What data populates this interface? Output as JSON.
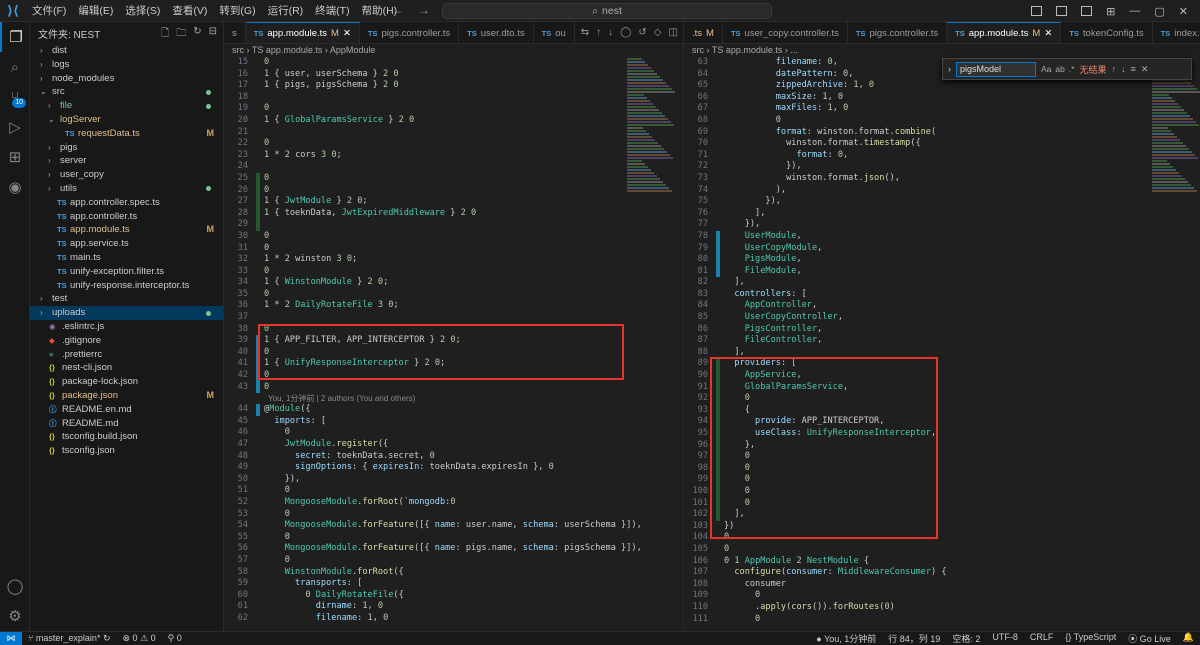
{
  "titlebar": {
    "menu": [
      "文件(F)",
      "编辑(E)",
      "选择(S)",
      "查看(V)",
      "转到(G)",
      "运行(R)",
      "终端(T)",
      "帮助(H)"
    ],
    "search": "nest"
  },
  "activity": {
    "scm_badge": "10"
  },
  "explorer": {
    "title": "文件夹: NEST",
    "items": [
      {
        "label": "dist",
        "indent": 0,
        "type": "folder",
        "open": false
      },
      {
        "label": "logs",
        "indent": 0,
        "type": "folder",
        "open": false
      },
      {
        "label": "node_modules",
        "indent": 0,
        "type": "folder",
        "open": false
      },
      {
        "label": "src",
        "indent": 0,
        "type": "folder",
        "open": true,
        "dot": true
      },
      {
        "label": "file",
        "indent": 1,
        "type": "folder",
        "open": false,
        "dot": true,
        "status": "green"
      },
      {
        "label": "logServer",
        "indent": 1,
        "type": "folder",
        "open": true,
        "status": "modified"
      },
      {
        "label": "requestData.ts",
        "indent": 2,
        "type": "ts",
        "badge": "M",
        "status": "modified"
      },
      {
        "label": "pigs",
        "indent": 1,
        "type": "folder",
        "open": false
      },
      {
        "label": "server",
        "indent": 1,
        "type": "folder",
        "open": false
      },
      {
        "label": "user_copy",
        "indent": 1,
        "type": "folder",
        "open": false
      },
      {
        "label": "utils",
        "indent": 1,
        "type": "folder",
        "open": false,
        "dot": true
      },
      {
        "label": "app.controller.spec.ts",
        "indent": 1,
        "type": "ts"
      },
      {
        "label": "app.controller.ts",
        "indent": 1,
        "type": "ts"
      },
      {
        "label": "app.module.ts",
        "indent": 1,
        "type": "ts",
        "badge": "M",
        "status": "modified"
      },
      {
        "label": "app.service.ts",
        "indent": 1,
        "type": "ts"
      },
      {
        "label": "main.ts",
        "indent": 1,
        "type": "ts"
      },
      {
        "label": "unify-exception.filter.ts",
        "indent": 1,
        "type": "ts"
      },
      {
        "label": "unify-response.interceptor.ts",
        "indent": 1,
        "type": "ts"
      },
      {
        "label": "test",
        "indent": 0,
        "type": "folder",
        "open": false
      },
      {
        "label": "uploads",
        "indent": 0,
        "type": "folder",
        "open": false,
        "dot": true,
        "selected": true
      },
      {
        "label": ".eslintrc.js",
        "indent": 0,
        "type": "eslint"
      },
      {
        "label": ".gitignore",
        "indent": 0,
        "type": "git"
      },
      {
        "label": ".prettierrc",
        "indent": 0,
        "type": "prettier"
      },
      {
        "label": "nest-cli.json",
        "indent": 0,
        "type": "json"
      },
      {
        "label": "package-lock.json",
        "indent": 0,
        "type": "json"
      },
      {
        "label": "package.json",
        "indent": 0,
        "type": "json",
        "badge": "M",
        "status": "modified"
      },
      {
        "label": "README.en.md",
        "indent": 0,
        "type": "md"
      },
      {
        "label": "README.md",
        "indent": 0,
        "type": "md"
      },
      {
        "label": "tsconfig.build.json",
        "indent": 0,
        "type": "json"
      },
      {
        "label": "tsconfig.json",
        "indent": 0,
        "type": "json"
      }
    ]
  },
  "left_editor": {
    "tabs": [
      {
        "label": "s",
        "prefix": ""
      },
      {
        "label": "app.module.ts",
        "prefix": "TS",
        "mod": "M",
        "active": true
      },
      {
        "label": "pigs.controller.ts",
        "prefix": "TS"
      },
      {
        "label": "user.dto.ts",
        "prefix": "TS"
      },
      {
        "label": "ou",
        "prefix": "TS"
      }
    ],
    "breadcrumb": [
      "src",
      "TS app.module.ts",
      "AppModule"
    ],
    "lens_text": "You, 1分钟前 | 2 authors (You and others)"
  },
  "right_editor": {
    "tabs": [
      {
        "label": ".ts",
        "prefix": "",
        "mod": "M",
        "modified": true
      },
      {
        "label": "user_copy.controller.ts",
        "prefix": "TS"
      },
      {
        "label": "pigs.controller.ts",
        "prefix": "TS"
      },
      {
        "label": "app.module.ts",
        "prefix": "TS",
        "mod": "M",
        "active": true
      },
      {
        "label": "tokenConfig.ts",
        "prefix": "TS"
      },
      {
        "label": "index.ts",
        "prefix": "TS"
      }
    ],
    "breadcrumb": [
      "src",
      "TS app.module.ts",
      "..."
    ],
    "find": {
      "query": "pigsModel",
      "result": "无结果",
      "opt_case": "Aa",
      "opt_word": "ab",
      "opt_regex": ".*"
    }
  },
  "status": {
    "branch": "master_explain*",
    "errors": "0",
    "warnings": "0",
    "ports": "0",
    "blame": "You, 1分钟前",
    "position": "行 84，列 19",
    "spaces": "空格: 2",
    "encoding": "UTF-8",
    "eol": "CRLF",
    "language": "TypeScript",
    "golive": "Go Live"
  }
}
